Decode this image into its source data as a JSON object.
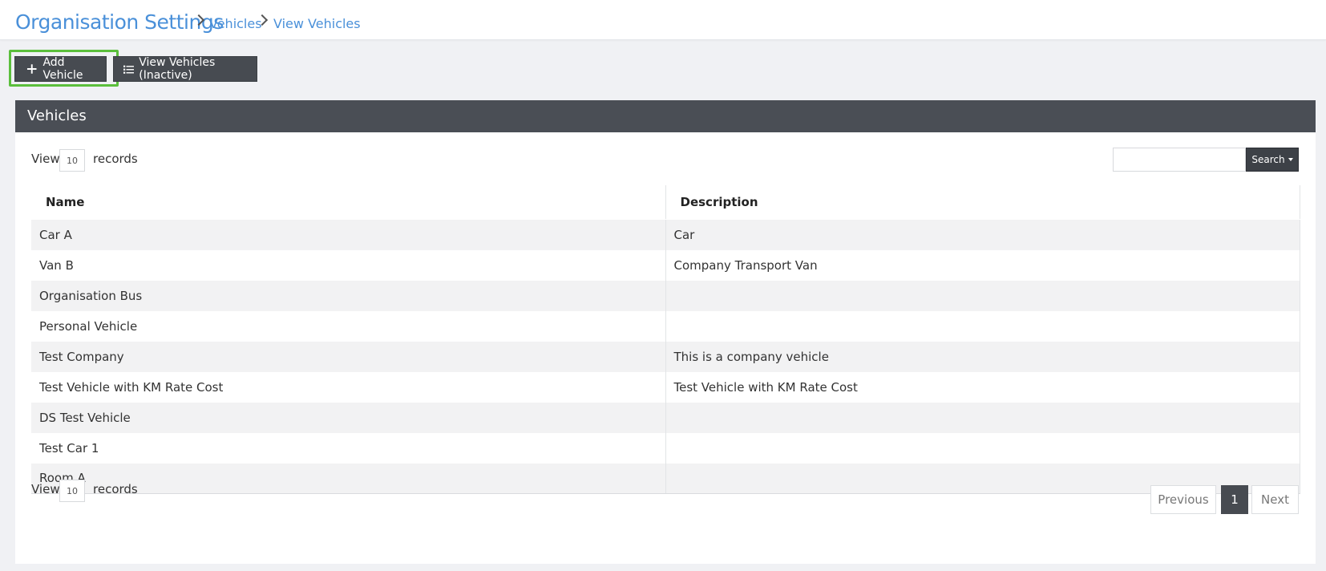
{
  "header": {
    "title": "Organisation Settings",
    "breadcrumbs": [
      "Vehicles",
      "View Vehicles"
    ]
  },
  "toolbar": {
    "add_label": "Add Vehicle",
    "inactive_label": "View Vehicles (Inactive)"
  },
  "panel": {
    "title": "Vehicles",
    "view_label": "View",
    "records_label": "records",
    "page_size": "10",
    "search_button": "Search",
    "search_value": ""
  },
  "table": {
    "columns": [
      "Name",
      "Description"
    ],
    "rows": [
      {
        "name": "Car A",
        "description": "Car"
      },
      {
        "name": "Van B",
        "description": "Company Transport Van"
      },
      {
        "name": "Organisation Bus",
        "description": ""
      },
      {
        "name": "Personal Vehicle",
        "description": ""
      },
      {
        "name": "Test Company",
        "description": "This is a company vehicle"
      },
      {
        "name": "Test Vehicle with KM Rate Cost",
        "description": "Test Vehicle with KM Rate Cost"
      },
      {
        "name": "DS Test Vehicle",
        "description": ""
      },
      {
        "name": "Test Car 1",
        "description": ""
      },
      {
        "name": "Room A",
        "description": ""
      }
    ]
  },
  "pagination": {
    "previous": "Previous",
    "current": "1",
    "next": "Next"
  },
  "colors": {
    "accent": "#4a90d9",
    "dark": "#474b51",
    "highlight": "#5bbf3c"
  },
  "icons": {
    "add": "plus-icon",
    "inactive": "list-icon",
    "breadcrumb": "chevron-right-icon"
  }
}
